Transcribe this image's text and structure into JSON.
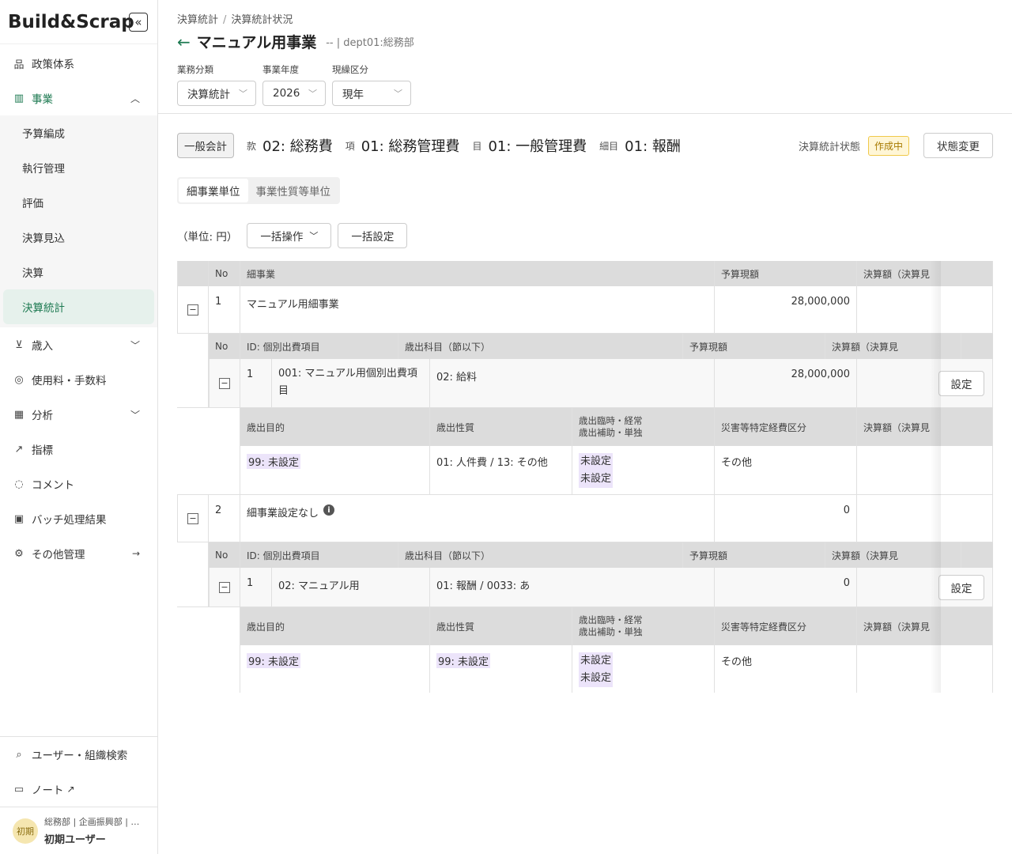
{
  "app": {
    "logo": "Build&Scrap",
    "collapse_icon": "«"
  },
  "sidebar": {
    "items": [
      {
        "label": "政策体系"
      },
      {
        "label": "事業"
      },
      {
        "label": "歳入"
      },
      {
        "label": "使用料・手数料"
      },
      {
        "label": "分析"
      },
      {
        "label": "指標"
      },
      {
        "label": "コメント"
      },
      {
        "label": "バッチ処理結果"
      },
      {
        "label": "その他管理"
      }
    ],
    "sub_items": [
      {
        "label": "予算編成"
      },
      {
        "label": "執行管理"
      },
      {
        "label": "評価"
      },
      {
        "label": "決算見込"
      },
      {
        "label": "決算"
      },
      {
        "label": "決算統計"
      }
    ],
    "bottom": [
      {
        "label": "ユーザー・組織検索"
      },
      {
        "label": "ノート"
      }
    ],
    "user": {
      "avatar": "初期",
      "org": "総務部 | 企画振興部 | …",
      "name": "初期ユーザー"
    },
    "accent_color": "#1e7a52"
  },
  "header": {
    "breadcrumb": [
      "決算統計",
      "決算統計状況"
    ],
    "title": "マニュアル用事業",
    "title_sub": "-- | dept01:総務部",
    "filters": [
      {
        "label": "業務分類",
        "value": "決算統計"
      },
      {
        "label": "事業年度",
        "value": "2026"
      },
      {
        "label": "現繰区分",
        "value": "現年"
      }
    ]
  },
  "info": {
    "account_button": "一般会計",
    "kan_label": "款",
    "kan_value": "02: 総務費",
    "kou_label": "項",
    "kou_value": "01: 総務管理費",
    "moku_label": "目",
    "moku_value": "01: 一般管理費",
    "saimoku_label": "細目",
    "saimoku_value": "01: 報酬",
    "status_label": "決算統計状態",
    "status_badge": "作成中",
    "status_button": "状態変更"
  },
  "tabs": [
    "細事業単位",
    "事業性質等単位"
  ],
  "toolbar": {
    "unit": "（単位: 円）",
    "bulk_op": "一括操作",
    "bulk_set": "一括設定"
  },
  "table": {
    "headers": {
      "no": "No",
      "detail": "細事業",
      "budget": "予算現額",
      "settle": "決算額（決算見"
    },
    "sub_headers": {
      "no": "No",
      "id": "ID: 個別出費項目",
      "subject": "歳出科目（節以下）",
      "budget": "予算現額",
      "settle": "決算額（決算見"
    },
    "attr_headers": {
      "purpose": "歳出目的",
      "nature": "歳出性質",
      "temp_line1": "歳出臨時・経常",
      "temp_line2": "歳出補助・単独",
      "disaster": "災害等特定経費区分",
      "settle": "決算額（決算見"
    },
    "setting_button": "設定",
    "rows": [
      {
        "no": "1",
        "name": "マニュアル用細事業",
        "budget": "28,000,000",
        "item": {
          "no": "1",
          "id": "001: マニュアル用個別出費項目",
          "subject": "02: 給料",
          "budget": "28,000,000"
        },
        "attrs": {
          "purpose": "99: 未設定",
          "nature": "01: 人件費 / 13: その他",
          "temp1": "未設定",
          "temp2": "未設定",
          "disaster": "その他"
        }
      },
      {
        "no": "2",
        "name": "細事業設定なし",
        "budget": "0",
        "item": {
          "no": "1",
          "id": "02: マニュアル用",
          "subject": "01: 報酬 / 0033: あ",
          "budget": "0"
        },
        "attrs": {
          "purpose": "99: 未設定",
          "nature": "99: 未設定",
          "temp1": "未設定",
          "temp2": "未設定",
          "disaster": "その他"
        }
      }
    ]
  }
}
